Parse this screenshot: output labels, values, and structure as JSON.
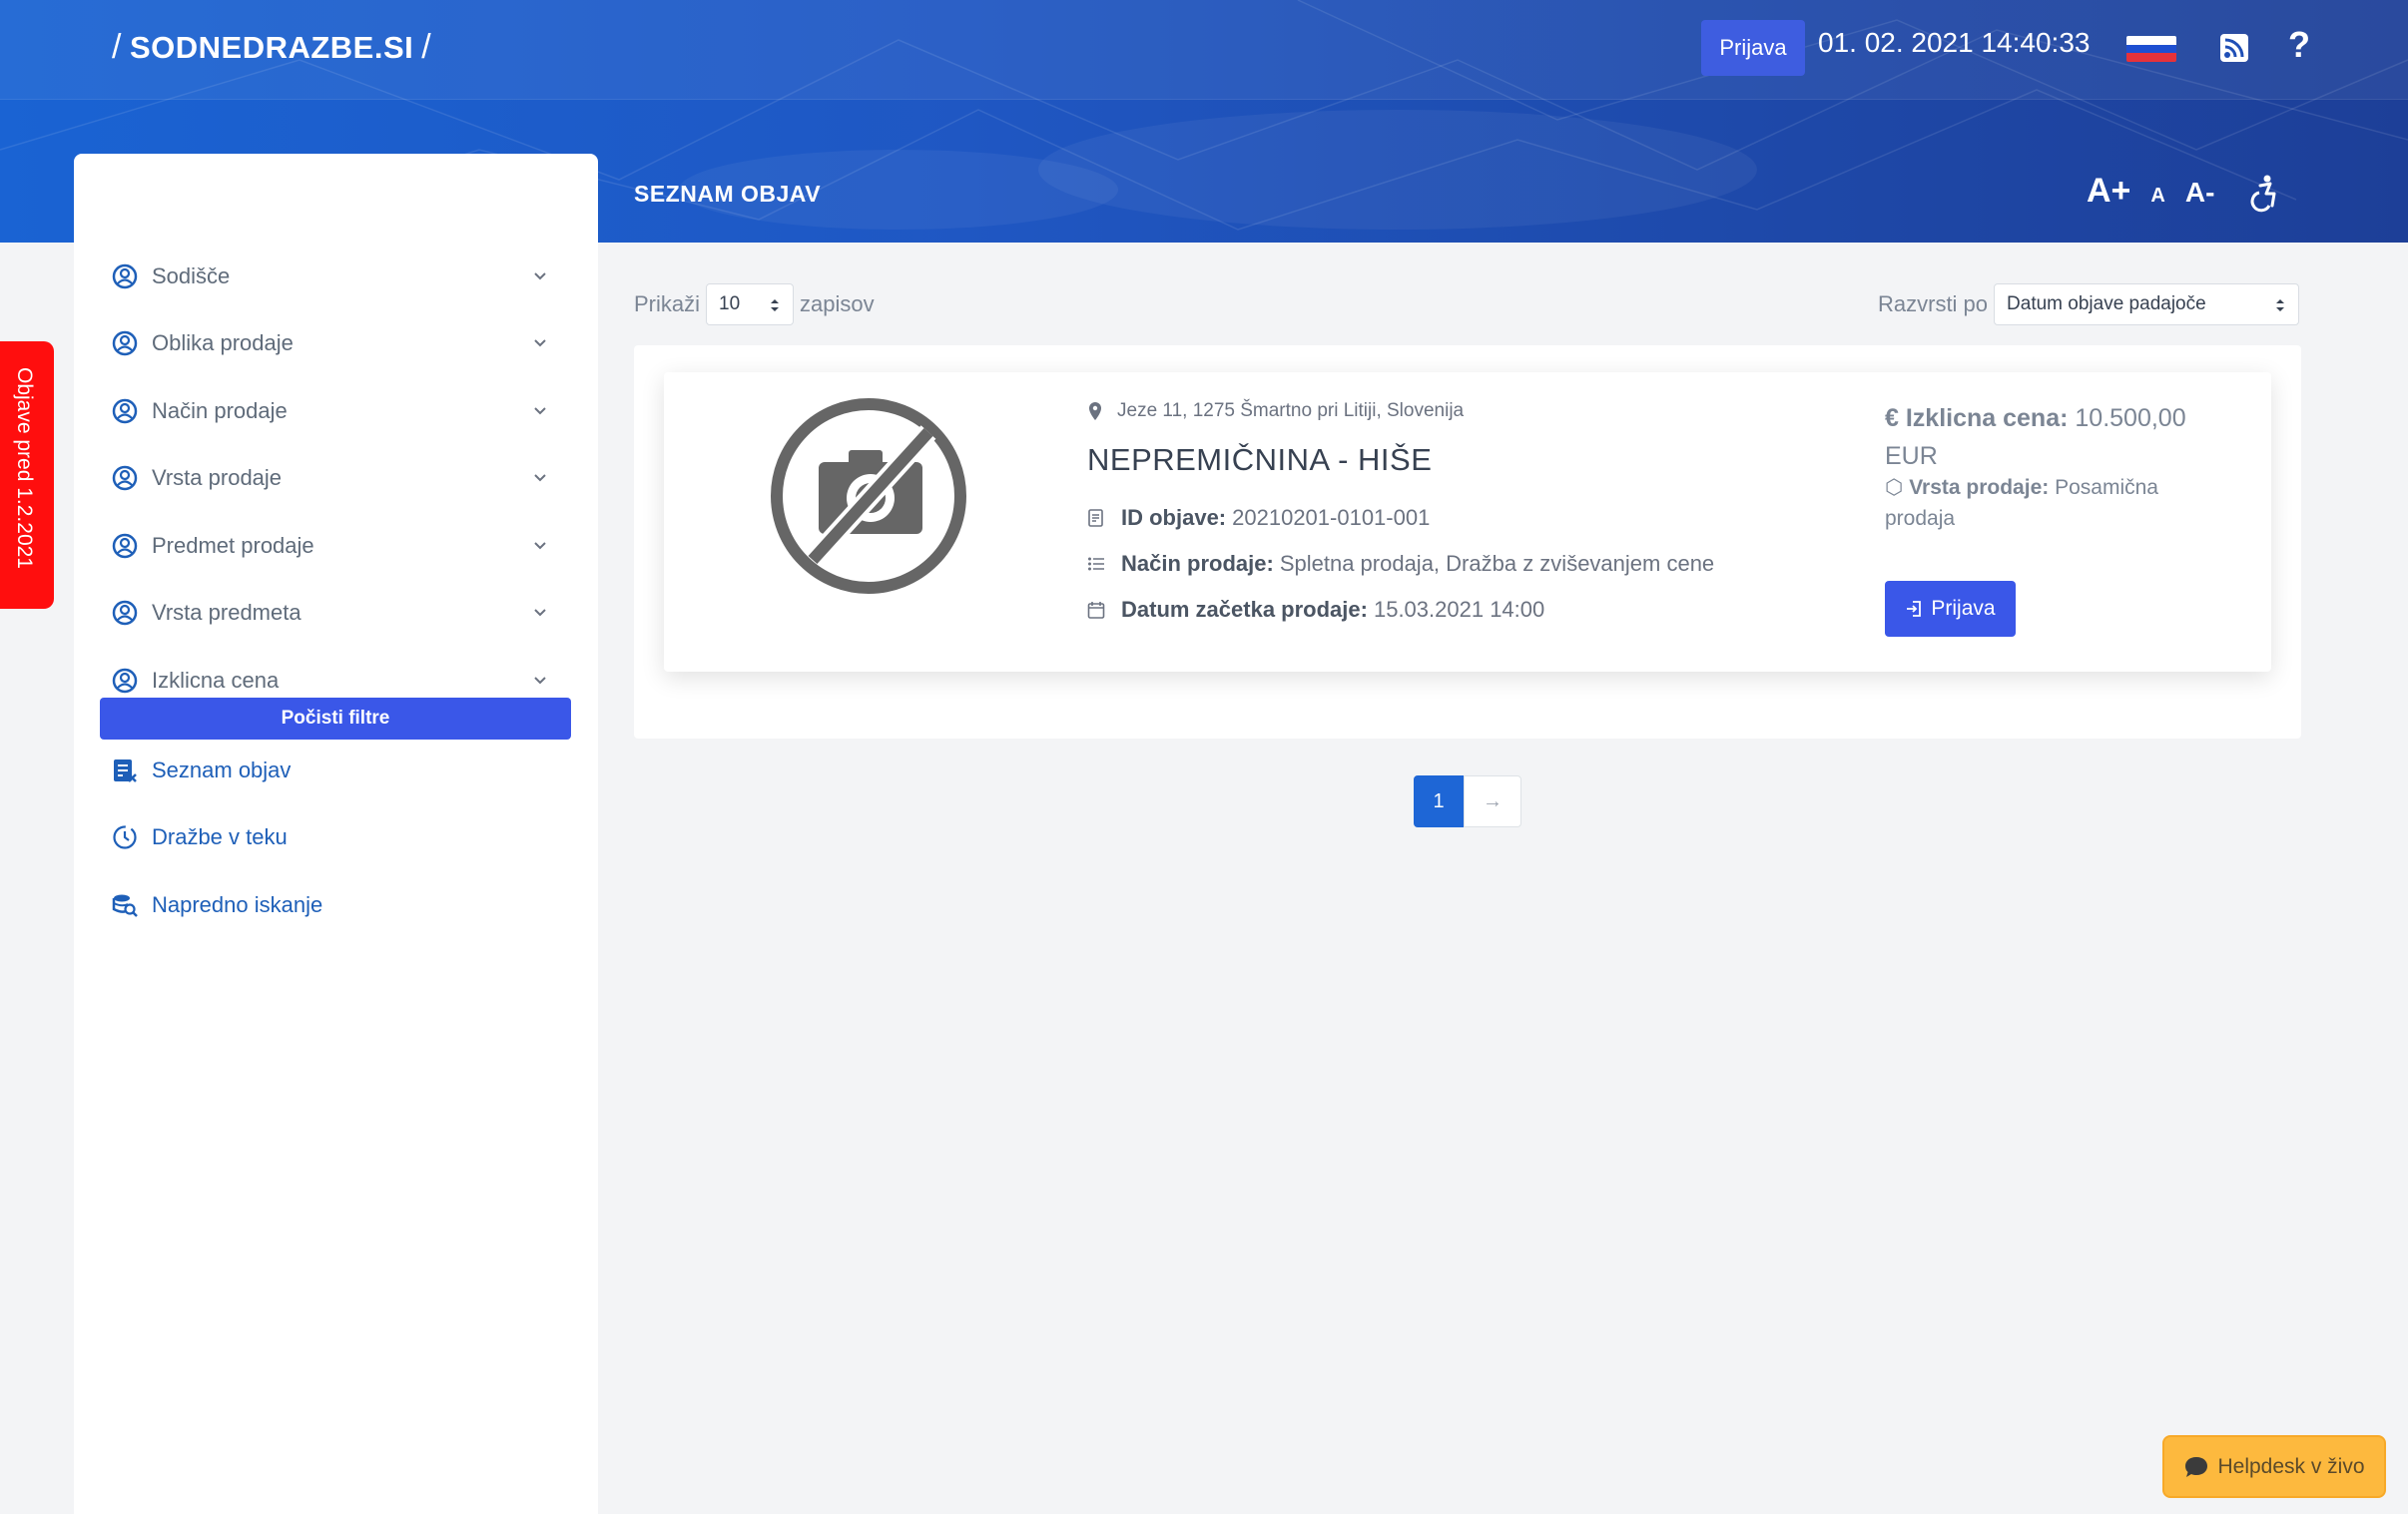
{
  "header": {
    "logo_text": "SODNEDRAZBE.SI",
    "logo_slash_left": "/",
    "logo_slash_right": "/",
    "login_label": "Prijava",
    "datetime": "01. 02. 2021 14:40:33",
    "help_label": "?",
    "page_title": "SEZNAM OBJAV",
    "font_increase": "A+",
    "font_reset": "A",
    "font_decrease": "A-"
  },
  "side_tab": {
    "label": "Objave pred 1.2.2021",
    "color": "#ff0e0e"
  },
  "sidebar": {
    "filters": [
      {
        "label": "Sodišče"
      },
      {
        "label": "Oblika prodaje"
      },
      {
        "label": "Način prodaje"
      },
      {
        "label": "Vrsta prodaje"
      },
      {
        "label": "Predmet prodaje"
      },
      {
        "label": "Vrsta predmeta"
      },
      {
        "label": "Izklicna cena"
      }
    ],
    "clear_filters_label": "Počisti filtre",
    "links": [
      {
        "label": "Seznam objav",
        "icon": "list-x-icon"
      },
      {
        "label": "Dražbe v teku",
        "icon": "clock-icon"
      },
      {
        "label": "Napredno iskanje",
        "icon": "db-search-icon"
      }
    ]
  },
  "list_controls": {
    "show_prefix": "Prikaži",
    "page_size": "10",
    "show_suffix": "zapisov",
    "sort_label": "Razvrsti po",
    "sort_value": "Datum objave padajoče"
  },
  "listing": {
    "address": "Jeze 11, 1275 Šmartno pri Litiji, Slovenija",
    "title": "NEPREMIČNINA - HIŠE",
    "id_label": "ID objave:",
    "id_value": "20210201-0101-001",
    "method_label": "Način prodaje:",
    "method_value": "Spletna prodaja, Dražba z zviševanjem cene",
    "start_label": "Datum začetka prodaje:",
    "start_value": "15.03.2021 14:00",
    "price_label": "Izklicna cena:",
    "price_value": "10.500,00 EUR",
    "kind_label": "Vrsta prodaje:",
    "kind_value": "Posamična prodaja",
    "login_label": "Prijava"
  },
  "pagination": {
    "current": "1",
    "next": "→"
  },
  "helpdesk": {
    "label": "Helpdesk v živo",
    "color": "#fdb93e"
  },
  "colors": {
    "primary": "#3a57e8",
    "header_blue": "#1f57c3",
    "link_blue": "#1e5fb8"
  }
}
